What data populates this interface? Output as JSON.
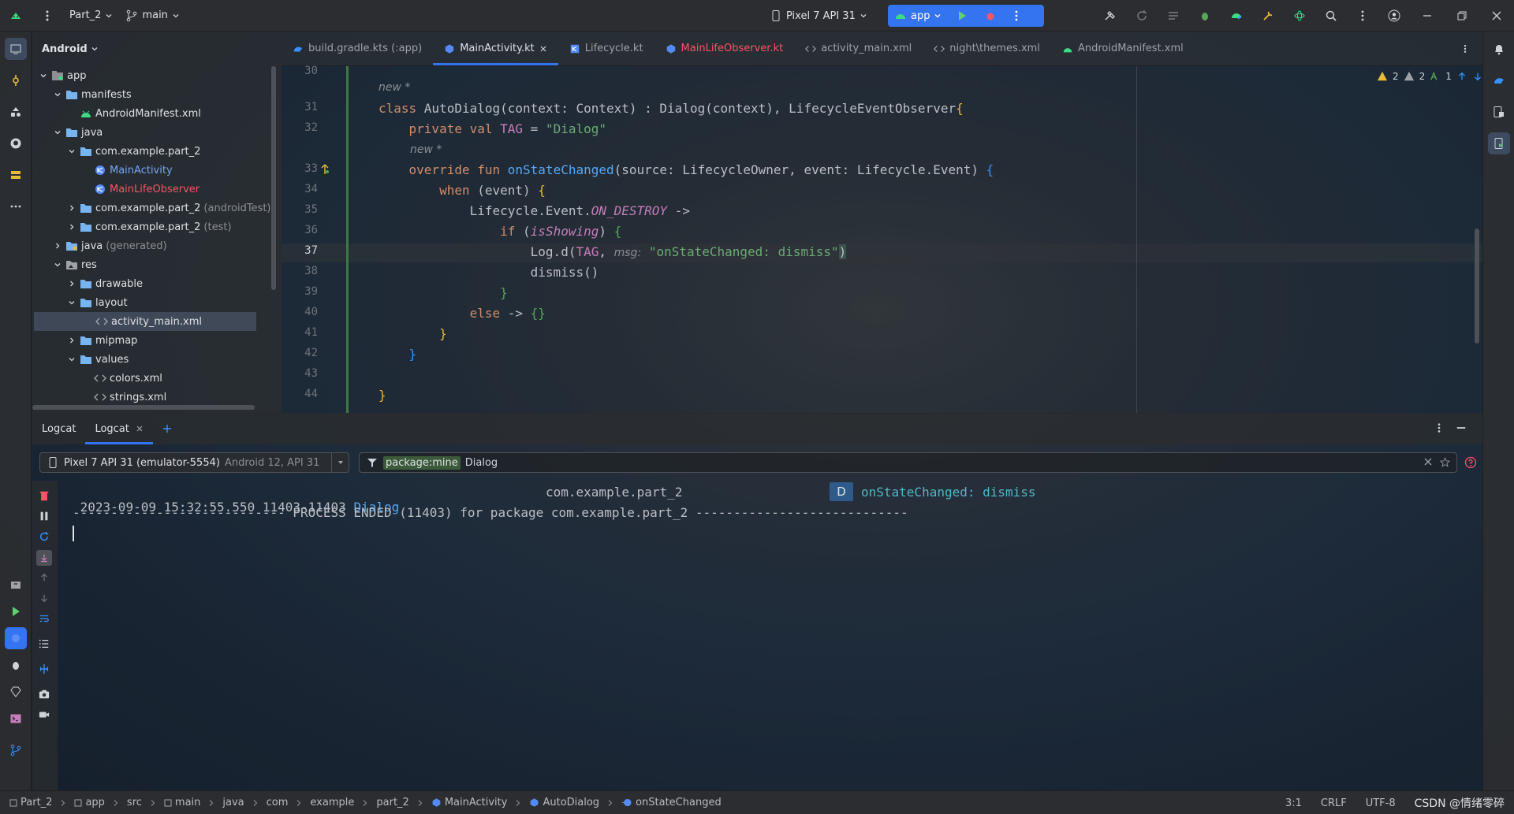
{
  "topbar": {
    "project": "Part_2",
    "branch": "main",
    "device": "Pixel 7 API 31",
    "run_config": "app"
  },
  "project_panel": {
    "view": "Android",
    "tree": [
      {
        "label": "app",
        "depth": 0,
        "kind": "module",
        "open": true
      },
      {
        "label": "manifests",
        "depth": 1,
        "kind": "folder",
        "open": true
      },
      {
        "label": "AndroidManifest.xml",
        "depth": 2,
        "kind": "android",
        "leaf": true
      },
      {
        "label": "java",
        "depth": 1,
        "kind": "folder",
        "open": true
      },
      {
        "label": "com.example.part_2",
        "depth": 2,
        "kind": "folder",
        "open": true
      },
      {
        "label": "MainActivity",
        "depth": 3,
        "kind": "kotlin",
        "leaf": true
      },
      {
        "label": "MainLifeObserver",
        "depth": 3,
        "kind": "kotlin",
        "leaf": true,
        "color": "#f75464"
      },
      {
        "label": "com.example.part_2",
        "depth": 2,
        "kind": "folder",
        "open": false,
        "note": "(androidTest)"
      },
      {
        "label": "com.example.part_2",
        "depth": 2,
        "kind": "folder",
        "open": false,
        "note": "(test)"
      },
      {
        "label": "java",
        "depth": 1,
        "kind": "folder-gen",
        "open": false,
        "note": "(generated)"
      },
      {
        "label": "res",
        "depth": 1,
        "kind": "res",
        "open": true
      },
      {
        "label": "drawable",
        "depth": 2,
        "kind": "folder",
        "open": false
      },
      {
        "label": "layout",
        "depth": 2,
        "kind": "folder",
        "open": true
      },
      {
        "label": "activity_main.xml",
        "depth": 3,
        "kind": "xml",
        "leaf": true,
        "selected": true
      },
      {
        "label": "mipmap",
        "depth": 2,
        "kind": "folder",
        "open": false
      },
      {
        "label": "values",
        "depth": 2,
        "kind": "folder",
        "open": true
      },
      {
        "label": "colors.xml",
        "depth": 3,
        "kind": "xml",
        "leaf": true
      },
      {
        "label": "strings.xml",
        "depth": 3,
        "kind": "xml",
        "leaf": true
      }
    ]
  },
  "tabs": [
    {
      "label": "build.gradle.kts (:app)",
      "icon": "gradle-icon"
    },
    {
      "label": "MainActivity.kt",
      "icon": "kotlin-class-icon",
      "active": true,
      "closable": true
    },
    {
      "label": "Lifecycle.kt",
      "icon": "kotlin-file-icon"
    },
    {
      "label": "MainLifeObserver.kt",
      "icon": "kotlin-class-icon",
      "color": "#f75464"
    },
    {
      "label": "activity_main.xml",
      "icon": "xml-icon"
    },
    {
      "label": "night\\themes.xml",
      "icon": "xml-icon"
    },
    {
      "label": "AndroidManifest.xml",
      "icon": "android-icon"
    }
  ],
  "editor": {
    "inspections": {
      "errors": "2",
      "warnings": "2",
      "weak": "1"
    },
    "hint_new": "new *",
    "line_numbers": [
      "30",
      "31",
      "32",
      "33",
      "34",
      "35",
      "36",
      "37",
      "38",
      "39",
      "40",
      "41",
      "42",
      "43",
      "44"
    ],
    "current_line": "37",
    "code": {
      "l31_kw": "class ",
      "l31_name": "AutoDialog",
      "l31_rest": "(context: Context) : Dialog(context), LifecycleEventObserver",
      "l32_kw": "private val ",
      "l32_name": "TAG",
      "l32_eq": " = ",
      "l32_str": "\"Dialog\"",
      "l33_kw": "override fun ",
      "l33_name": "onStateChanged",
      "l33_rest": "(source: LifecycleOwner, event: Lifecycle.Event) ",
      "l34_kw": "when ",
      "l34_rest": "(event) ",
      "l35_pre": "Lifecycle.Event.",
      "l35_const": "ON_DESTROY",
      "l35_rest": " ->",
      "l36_kw": "if ",
      "l36_prop": "isShowing",
      "l37_pre": "Log.d(",
      "l37_tag": "TAG",
      "l37_comma": ", ",
      "l37_hint": "msg:",
      "l37_str": "\"onStateChanged: dismiss\"",
      "l38": "dismiss()",
      "l40_kw": "else ",
      "l40_rest": "-> ",
      "brace_open": "{",
      "brace_close": "}",
      "paren_close": ")",
      "braces_empty": "{}"
    }
  },
  "logcat": {
    "tabs": [
      "Logcat",
      "Logcat"
    ],
    "device": "Pixel 7 API 31 (emulator-5554)",
    "device_os": "Android 12, API 31",
    "filter_chip": "package:mine",
    "filter_text": "Dialog",
    "lines": [
      {
        "timestamp": "2023-09-09 15:32:55.550",
        "pid": "11403-11403",
        "tag": "Dialog",
        "package": "com.example.part_2",
        "level": "D",
        "message": "onStateChanged: dismiss"
      }
    ],
    "process_ended": "---------------------------- PROCESS ENDED (11403) for package com.example.part_2 ----------------------------"
  },
  "statusbar": {
    "breadcrumbs": [
      "Part_2",
      "app",
      "src",
      "main",
      "java",
      "com",
      "example",
      "part_2",
      "MainActivity",
      "AutoDialog",
      "onStateChanged"
    ],
    "position": "3:1",
    "line_sep": "CRLF",
    "encoding": "UTF-8",
    "watermark": "CSDN @情绪零碎"
  }
}
